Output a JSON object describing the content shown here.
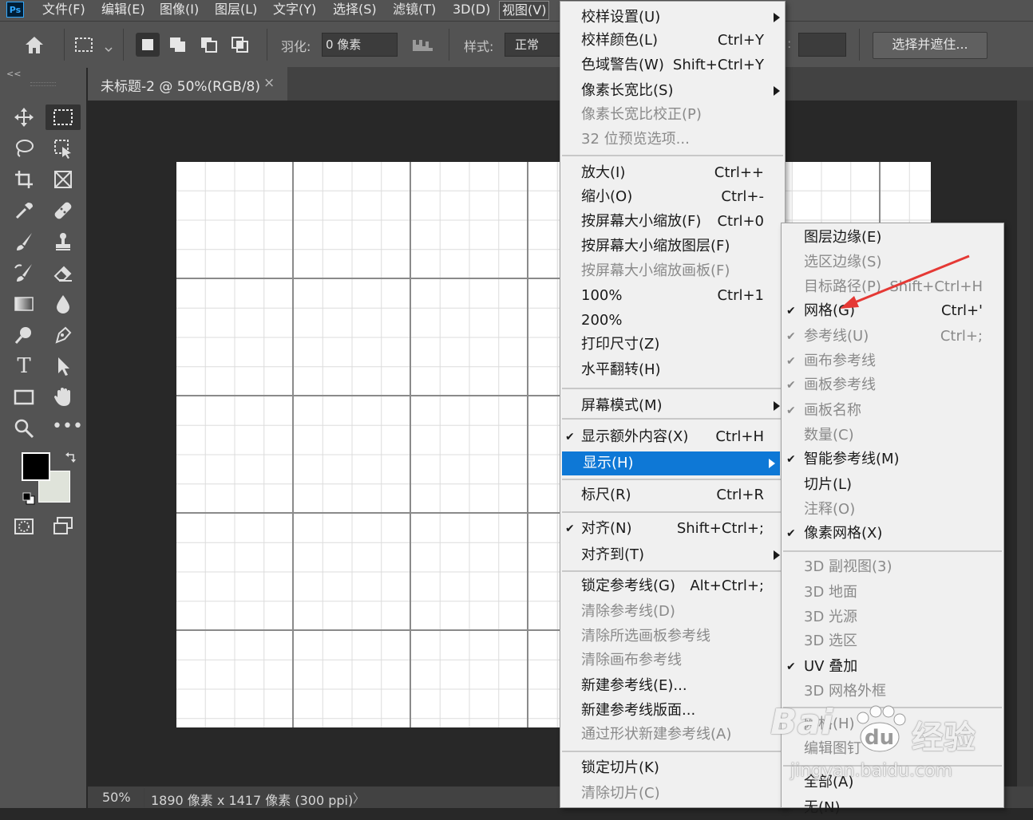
{
  "app": {
    "logo": "Ps"
  },
  "menubar": {
    "items": [
      "文件(F)",
      "编辑(E)",
      "图像(I)",
      "图层(L)",
      "文字(Y)",
      "选择(S)",
      "滤镜(T)",
      "3D(D)",
      "视图(V)"
    ],
    "active": "视图(V)"
  },
  "options": {
    "feather_label": "羽化:",
    "feather_value": "0 像素",
    "style_label": "样式:",
    "style_value": "正常",
    "mask_button": "选择并遮住..."
  },
  "panel_collapse": "<<",
  "document": {
    "tab_title": "未标题-2 @ 50%(RGB/8)",
    "close": "×"
  },
  "status": {
    "zoom": "50%",
    "info": "1890 像素 x 1417 像素 (300 ppi)",
    "arrow": "〉"
  },
  "view_menu": {
    "items": [
      {
        "label": "校样设置(U)",
        "shortcut": "",
        "submenu": true,
        "disabled": false,
        "checked": false
      },
      {
        "label": "校样颜色(L)",
        "shortcut": "Ctrl+Y",
        "submenu": false,
        "disabled": false,
        "checked": false
      },
      {
        "label": "色域警告(W)",
        "shortcut": "Shift+Ctrl+Y",
        "submenu": false,
        "disabled": false,
        "checked": false
      },
      {
        "label": "像素长宽比(S)",
        "shortcut": "",
        "submenu": true,
        "disabled": false,
        "checked": false
      },
      {
        "label": "像素长宽比校正(P)",
        "shortcut": "",
        "submenu": false,
        "disabled": true,
        "checked": false
      },
      {
        "label": "32 位预览选项...",
        "shortcut": "",
        "submenu": false,
        "disabled": true,
        "checked": false
      },
      {
        "label": "放大(I)",
        "shortcut": "Ctrl++",
        "submenu": false,
        "disabled": false,
        "checked": false
      },
      {
        "label": "缩小(O)",
        "shortcut": "Ctrl+-",
        "submenu": false,
        "disabled": false,
        "checked": false
      },
      {
        "label": "按屏幕大小缩放(F)",
        "shortcut": "Ctrl+0",
        "submenu": false,
        "disabled": false,
        "checked": false
      },
      {
        "label": "按屏幕大小缩放图层(F)",
        "shortcut": "",
        "submenu": false,
        "disabled": false,
        "checked": false
      },
      {
        "label": "按屏幕大小缩放画板(F)",
        "shortcut": "",
        "submenu": false,
        "disabled": true,
        "checked": false
      },
      {
        "label": "100%",
        "shortcut": "Ctrl+1",
        "submenu": false,
        "disabled": false,
        "checked": false
      },
      {
        "label": "200%",
        "shortcut": "",
        "submenu": false,
        "disabled": false,
        "checked": false
      },
      {
        "label": "打印尺寸(Z)",
        "shortcut": "",
        "submenu": false,
        "disabled": false,
        "checked": false
      },
      {
        "label": "水平翻转(H)",
        "shortcut": "",
        "submenu": false,
        "disabled": false,
        "checked": false
      },
      {
        "label": "屏幕模式(M)",
        "shortcut": "",
        "submenu": true,
        "disabled": false,
        "checked": false
      },
      {
        "label": "显示额外内容(X)",
        "shortcut": "Ctrl+H",
        "submenu": false,
        "disabled": false,
        "checked": true
      },
      {
        "label": "显示(H)",
        "shortcut": "",
        "submenu": true,
        "disabled": false,
        "checked": false,
        "highlighted": true
      },
      {
        "label": "标尺(R)",
        "shortcut": "Ctrl+R",
        "submenu": false,
        "disabled": false,
        "checked": false
      },
      {
        "label": "对齐(N)",
        "shortcut": "Shift+Ctrl+;",
        "submenu": false,
        "disabled": false,
        "checked": true
      },
      {
        "label": "对齐到(T)",
        "shortcut": "",
        "submenu": true,
        "disabled": false,
        "checked": false
      },
      {
        "label": "锁定参考线(G)",
        "shortcut": "Alt+Ctrl+;",
        "submenu": false,
        "disabled": false,
        "checked": false
      },
      {
        "label": "清除参考线(D)",
        "shortcut": "",
        "submenu": false,
        "disabled": true,
        "checked": false
      },
      {
        "label": "清除所选画板参考线",
        "shortcut": "",
        "submenu": false,
        "disabled": true,
        "checked": false
      },
      {
        "label": "清除画布参考线",
        "shortcut": "",
        "submenu": false,
        "disabled": true,
        "checked": false
      },
      {
        "label": "新建参考线(E)...",
        "shortcut": "",
        "submenu": false,
        "disabled": false,
        "checked": false
      },
      {
        "label": "新建参考线版面...",
        "shortcut": "",
        "submenu": false,
        "disabled": false,
        "checked": false
      },
      {
        "label": "通过形状新建参考线(A)",
        "shortcut": "",
        "submenu": false,
        "disabled": true,
        "checked": false
      },
      {
        "label": "锁定切片(K)",
        "shortcut": "",
        "submenu": false,
        "disabled": false,
        "checked": false
      },
      {
        "label": "清除切片(C)",
        "shortcut": "",
        "submenu": false,
        "disabled": true,
        "checked": false
      }
    ]
  },
  "show_submenu": {
    "items": [
      {
        "label": "图层边缘(E)",
        "shortcut": "",
        "disabled": false,
        "checked": false
      },
      {
        "label": "选区边缘(S)",
        "shortcut": "",
        "disabled": true,
        "checked": false
      },
      {
        "label": "目标路径(P)",
        "shortcut": "Shift+Ctrl+H",
        "disabled": true,
        "checked": false
      },
      {
        "label": "网格(G)",
        "shortcut": "Ctrl+'",
        "disabled": false,
        "checked": true
      },
      {
        "label": "参考线(U)",
        "shortcut": "Ctrl+;",
        "disabled": true,
        "checked": true
      },
      {
        "label": "画布参考线",
        "shortcut": "",
        "disabled": true,
        "checked": true
      },
      {
        "label": "画板参考线",
        "shortcut": "",
        "disabled": true,
        "checked": true
      },
      {
        "label": "画板名称",
        "shortcut": "",
        "disabled": true,
        "checked": true
      },
      {
        "label": "数量(C)",
        "shortcut": "",
        "disabled": true,
        "checked": false
      },
      {
        "label": "智能参考线(M)",
        "shortcut": "",
        "disabled": false,
        "checked": true
      },
      {
        "label": "切片(L)",
        "shortcut": "",
        "disabled": false,
        "checked": false
      },
      {
        "label": "注释(O)",
        "shortcut": "",
        "disabled": true,
        "checked": false
      },
      {
        "label": "像素网格(X)",
        "shortcut": "",
        "disabled": false,
        "checked": true
      },
      {
        "label": "3D 副视图(3)",
        "shortcut": "",
        "disabled": true,
        "checked": false
      },
      {
        "label": "3D 地面",
        "shortcut": "",
        "disabled": true,
        "checked": false
      },
      {
        "label": "3D 光源",
        "shortcut": "",
        "disabled": true,
        "checked": false
      },
      {
        "label": "3D 选区",
        "shortcut": "",
        "disabled": true,
        "checked": false
      },
      {
        "label": "UV 叠加",
        "shortcut": "",
        "disabled": false,
        "checked": true
      },
      {
        "label": "3D 网格外框",
        "shortcut": "",
        "disabled": true,
        "checked": false
      },
      {
        "label": "网格(H)",
        "shortcut": "",
        "disabled": true,
        "checked": false
      },
      {
        "label": "编辑图钉",
        "shortcut": "",
        "disabled": true,
        "checked": false
      },
      {
        "label": "全部(A)",
        "shortcut": "",
        "disabled": false,
        "checked": false
      },
      {
        "label": "无(N)",
        "shortcut": "",
        "disabled": false,
        "checked": false
      }
    ]
  },
  "watermark": {
    "brand": "Bai",
    "du": "du",
    "jingyan": "经验",
    "url": "jingyan.baidu.com"
  },
  "colors": {
    "accent": "#0e78d6",
    "annotation_arrow": "#e53935",
    "foreground": "#000000",
    "background": "#dfe3da"
  }
}
